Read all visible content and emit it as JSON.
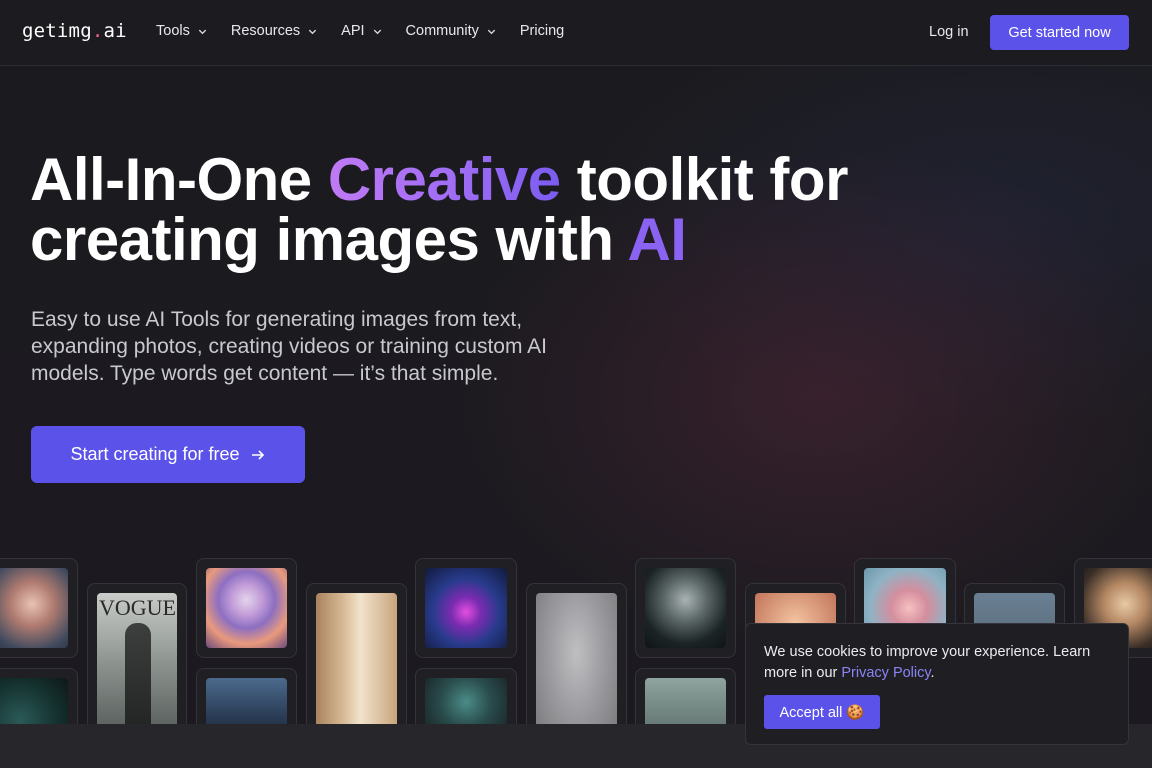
{
  "nav": {
    "logo_main": "getimg",
    "logo_dot": ".",
    "logo_suffix": "ai",
    "items": [
      {
        "label": "Tools",
        "dropdown": true
      },
      {
        "label": "Resources",
        "dropdown": true
      },
      {
        "label": "API",
        "dropdown": true
      },
      {
        "label": "Community",
        "dropdown": true
      },
      {
        "label": "Pricing",
        "dropdown": false
      }
    ],
    "login": "Log in",
    "cta": "Get started now"
  },
  "hero": {
    "h1_part1": "All-In-One ",
    "h1_highlight1": "Creative",
    "h1_part2": " toolkit for creating images with ",
    "h1_highlight2": "AI",
    "subtitle": "Easy to use AI Tools for generating images from text, expanding photos, creating videos or training custom AI models. Type words get content — it’s that simple.",
    "button": "Start creating for free"
  },
  "cookie": {
    "text_before": "We use cookies to improve your experience. Learn more in our ",
    "link": "Privacy Policy",
    "text_after": ".",
    "accept": "Accept all 🍪"
  },
  "gallery": {
    "vogue_text": "VOGUE"
  },
  "colors": {
    "accent": "#5b52ea",
    "gradient_start": "#c07af5",
    "gradient_end": "#7a5cf0",
    "logo_dot": "#f0628b",
    "link": "#8a84f5"
  }
}
